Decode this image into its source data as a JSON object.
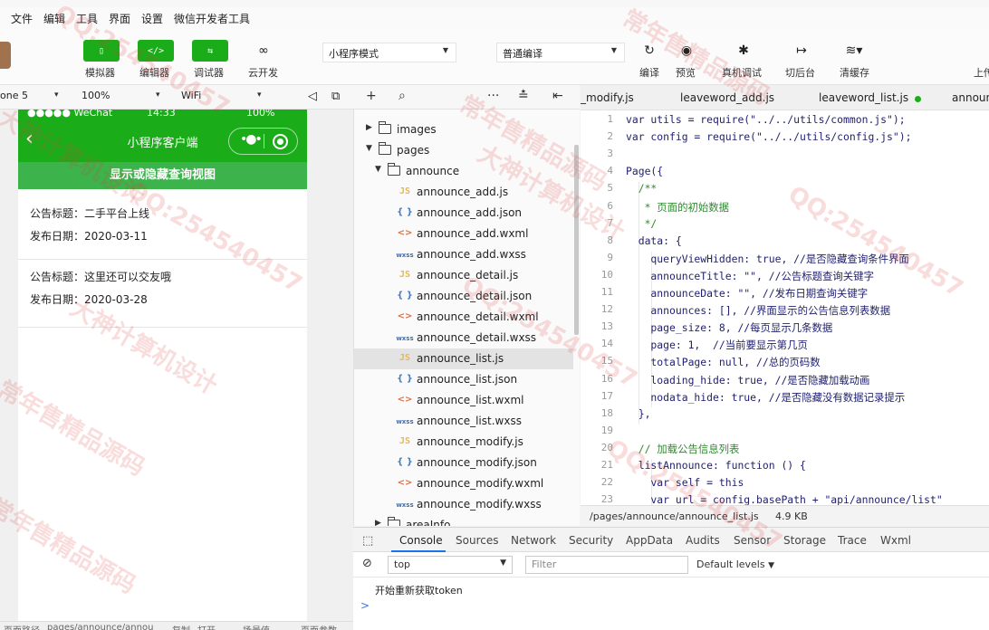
{
  "menu": [
    "文件",
    "编辑",
    "工具",
    "界面",
    "设置",
    "微信开发者工具"
  ],
  "toolbar": {
    "simulator": "模拟器",
    "editor": "编辑器",
    "debugger": "调试器",
    "cloud": "云开发",
    "mode_select": "小程序模式",
    "compile_select": "普通编译",
    "compile": "编译",
    "preview": "预览",
    "real_debug": "真机调试",
    "background": "切后台",
    "clear_cache": "清缓存",
    "upload": "上传"
  },
  "sim_bar": {
    "device": "one 5",
    "zoom": "100%",
    "network": "WiFi"
  },
  "phone": {
    "status_left": "●●●●● WeChat",
    "status_time": "14:33",
    "status_battery": "100%",
    "nav_title": "小程序客户端",
    "toggle_button": "显示或隐藏查询视图",
    "announcements": [
      {
        "title": "公告标题：二手平台上线",
        "date": "发布日期：2020-03-11"
      },
      {
        "title": "公告标题：这里还可以交友哦",
        "date": "发布日期：2020-03-28"
      }
    ]
  },
  "tree": {
    "rows": [
      {
        "kind": "folder",
        "name": "images",
        "indent": 0,
        "arrow": "▶",
        "expanded": false
      },
      {
        "kind": "folder",
        "name": "pages",
        "indent": 0,
        "arrow": "▼",
        "expanded": true
      },
      {
        "kind": "folder",
        "name": "announce",
        "indent": 1,
        "arrow": "▼",
        "expanded": true
      },
      {
        "kind": "js",
        "icon": "JS",
        "name": "announce_add.js"
      },
      {
        "kind": "json",
        "icon": "{ }",
        "name": "announce_add.json"
      },
      {
        "kind": "wxml",
        "icon": "<>",
        "name": "announce_add.wxml"
      },
      {
        "kind": "wxss",
        "icon": "wxss",
        "name": "announce_add.wxss"
      },
      {
        "kind": "js",
        "icon": "JS",
        "name": "announce_detail.js"
      },
      {
        "kind": "json",
        "icon": "{ }",
        "name": "announce_detail.json"
      },
      {
        "kind": "wxml",
        "icon": "<>",
        "name": "announce_detail.wxml"
      },
      {
        "kind": "wxss",
        "icon": "wxss",
        "name": "announce_detail.wxss"
      },
      {
        "kind": "js",
        "icon": "JS",
        "name": "announce_list.js",
        "selected": true
      },
      {
        "kind": "json",
        "icon": "{ }",
        "name": "announce_list.json"
      },
      {
        "kind": "wxml",
        "icon": "<>",
        "name": "announce_list.wxml"
      },
      {
        "kind": "wxss",
        "icon": "wxss",
        "name": "announce_list.wxss"
      },
      {
        "kind": "js",
        "icon": "JS",
        "name": "announce_modify.js"
      },
      {
        "kind": "json",
        "icon": "{ }",
        "name": "announce_modify.json"
      },
      {
        "kind": "wxml",
        "icon": "<>",
        "name": "announce_modify.wxml"
      },
      {
        "kind": "wxss",
        "icon": "wxss",
        "name": "announce_modify.wxss"
      },
      {
        "kind": "folder",
        "name": "areaInfo",
        "indent": 1,
        "arrow": "▶",
        "expanded": false
      }
    ]
  },
  "editor_tabs": [
    "_modify.js",
    "leaveword_add.js",
    "leaveword_list.js",
    "announ"
  ],
  "code_lines": [
    "var utils = require(\"../../utils/common.js\");",
    "var config = require(\"../../utils/config.js\");",
    "",
    "Page({",
    "  /**",
    "   * 页面的初始数据",
    "   */",
    "  data: {",
    "    queryViewHidden: true, //是否隐藏查询条件界面",
    "    announceTitle: \"\", //公告标题查询关键字",
    "    announceDate: \"\", //发布日期查询关键字",
    "    announces: [], //界面显示的公告信息列表数据",
    "    page_size: 8, //每页显示几条数据",
    "    page: 1,  //当前要显示第几页",
    "    totalPage: null, //总的页码数",
    "    loading_hide: true, //是否隐藏加载动画",
    "    nodata_hide: true, //是否隐藏没有数据记录提示",
    "  },",
    "",
    "  // 加载公告信息列表",
    "  listAnnounce: function () {",
    "    var self = this",
    "    var url = config.basePath + \"api/announce/list\""
  ],
  "file_status": {
    "path": "/pages/announce/announce_list.js",
    "size": "4.9 KB"
  },
  "devtools_tabs": [
    "Console",
    "Sources",
    "Network",
    "Security",
    "AppData",
    "Audits",
    "Sensor",
    "Storage",
    "Trace",
    "Wxml"
  ],
  "console": {
    "context": "top",
    "filter_placeholder": "Filter",
    "levels": "Default levels",
    "message": "开始重新获取token",
    "prompt": ">"
  },
  "bottom_status": [
    "页面路径",
    "pages/announce/annou",
    "复制",
    "打开",
    "场景值",
    "页面参数"
  ],
  "watermarks": [
    "QQ:254540457",
    "常年售精品源码",
    "大神计算机设计",
    "QQ:254540457",
    "常年售精品源码",
    "大神计算机设计",
    "QQ:254540457",
    "常年售精品源码",
    "大神计算机设计",
    "QQ:254540457",
    "常年售精品源码",
    "QQ:254540457"
  ],
  "colors": {
    "wechat_green": "#1aad19",
    "toggle_green": "#3cb34b",
    "active_blue": "#1a73e8"
  }
}
